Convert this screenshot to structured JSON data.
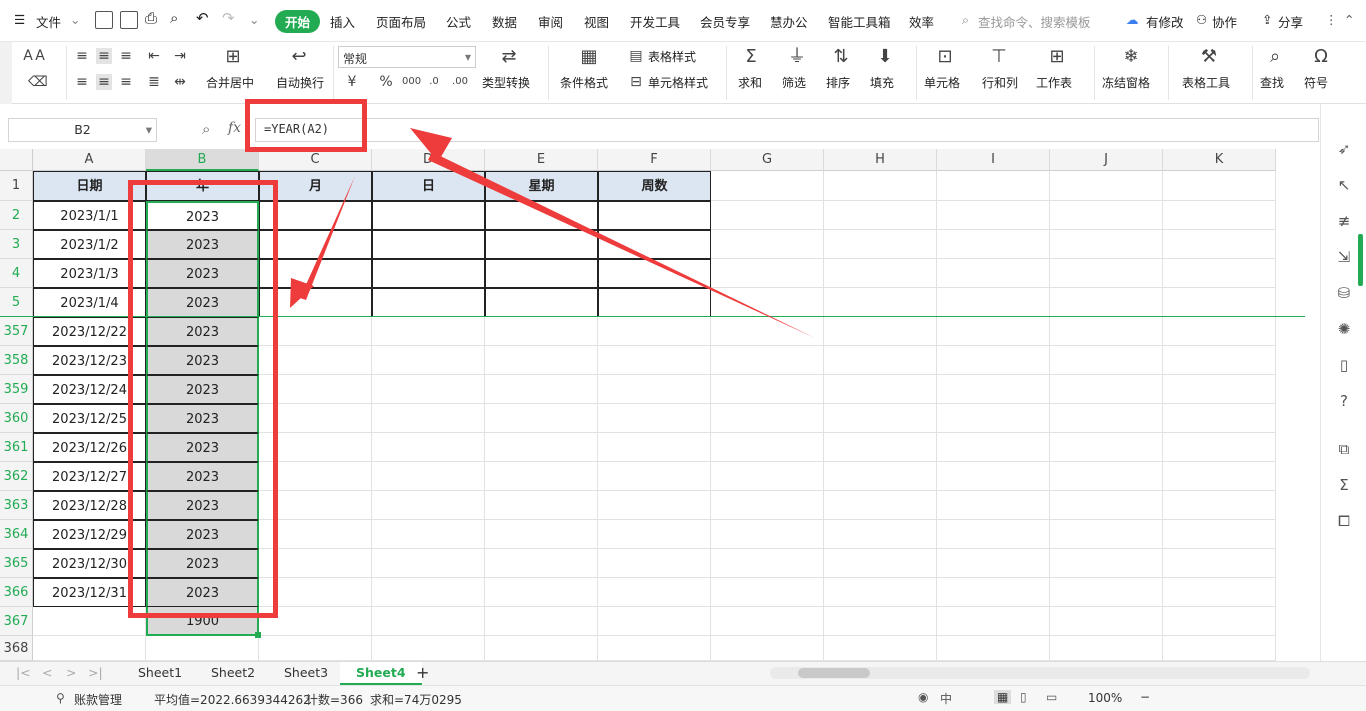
{
  "menubar": {
    "file": "文件",
    "tabs": [
      "开始",
      "插入",
      "页面布局",
      "公式",
      "数据",
      "审阅",
      "视图",
      "开发工具",
      "会员专享",
      "慧办公",
      "智能工具箱",
      "效率"
    ],
    "search_placeholder": "查找命令、搜索模板",
    "has_changes": "有修改",
    "collab": "协作",
    "share": "分享"
  },
  "ribbon": {
    "merge_center": "合并居中",
    "wrap_text": "自动换行",
    "number_format": "常规",
    "type_convert": "类型转换",
    "cond_format": "条件格式",
    "table_style": "表格样式",
    "cell_style": "单元格样式",
    "sum": "求和",
    "filter": "筛选",
    "sort": "排序",
    "fill": "填充",
    "cell": "单元格",
    "row_col": "行和列",
    "worksheet": "工作表",
    "freeze": "冻结窗格",
    "table_tools": "表格工具",
    "find": "查找",
    "symbol": "符号"
  },
  "formula_bar": {
    "name_box": "B2",
    "fx": "fx",
    "formula": "=YEAR(A2)"
  },
  "columns": [
    "A",
    "B",
    "C",
    "D",
    "E",
    "F",
    "G",
    "H",
    "I",
    "J",
    "K"
  ],
  "header_row": {
    "row": "1",
    "cells": [
      "日期",
      "年",
      "月",
      "日",
      "星期",
      "周数"
    ]
  },
  "rows": [
    {
      "row": "2",
      "date": "2023/1/1",
      "year": "2023"
    },
    {
      "row": "3",
      "date": "2023/1/2",
      "year": "2023"
    },
    {
      "row": "4",
      "date": "2023/1/3",
      "year": "2023"
    },
    {
      "row": "5",
      "date": "2023/1/4",
      "year": "2023"
    },
    {
      "row": "357",
      "date": "2023/12/22",
      "year": "2023"
    },
    {
      "row": "358",
      "date": "2023/12/23",
      "year": "2023"
    },
    {
      "row": "359",
      "date": "2023/12/24",
      "year": "2023"
    },
    {
      "row": "360",
      "date": "2023/12/25",
      "year": "2023"
    },
    {
      "row": "361",
      "date": "2023/12/26",
      "year": "2023"
    },
    {
      "row": "362",
      "date": "2023/12/27",
      "year": "2023"
    },
    {
      "row": "363",
      "date": "2023/12/28",
      "year": "2023"
    },
    {
      "row": "364",
      "date": "2023/12/29",
      "year": "2023"
    },
    {
      "row": "365",
      "date": "2023/12/30",
      "year": "2023"
    },
    {
      "row": "366",
      "date": "2023/12/31",
      "year": "2023"
    },
    {
      "row": "367",
      "date": "",
      "year": "1900"
    },
    {
      "row": "368",
      "date": "",
      "year": ""
    }
  ],
  "sheets": [
    "Sheet1",
    "Sheet2",
    "Sheet3",
    "Sheet4"
  ],
  "active_sheet": "Sheet4",
  "status": {
    "account": "账款管理",
    "average": "平均值=2022.6639344262",
    "count": "计数=366",
    "sum": "求和=74万0295",
    "zoom": "100%"
  },
  "colors": {
    "accent": "#22ab53",
    "annotation": "#ee3b3b",
    "selection": "#d9d9d9"
  }
}
